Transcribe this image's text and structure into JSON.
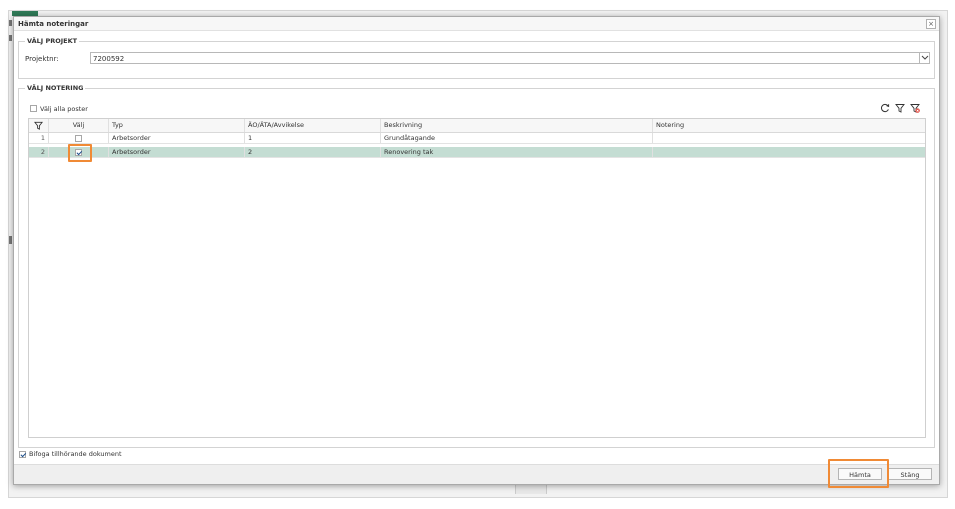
{
  "dialog": {
    "title": "Hämta noteringar",
    "close_glyph": "×"
  },
  "project_section": {
    "legend": "VÄLJ PROJEKT",
    "label": "Projektnr:",
    "value": "7200592"
  },
  "notes_section": {
    "legend": "VÄLJ NOTERING",
    "select_all_label": "Välj alla poster",
    "select_all_checked": false,
    "toolbar_icons": [
      "refresh-icon",
      "filter-icon",
      "clear-filter-icon"
    ]
  },
  "grid": {
    "columns": [
      "Välj",
      "Typ",
      "ÄO/ÄTA/Avvikelse",
      "Beskrivning",
      "Notering"
    ],
    "rows": [
      {
        "num": "1",
        "checked": false,
        "typ": "Arbetsorder",
        "code": "1",
        "beskrivning": "Grundåtagande",
        "notering": ""
      },
      {
        "num": "2",
        "checked": true,
        "typ": "Arbetsorder",
        "code": "2",
        "beskrivning": "Renovering tak",
        "notering": ""
      }
    ],
    "selected_row": 2
  },
  "attach": {
    "label": "Bifoga tillhörande dokument",
    "checked": true
  },
  "buttons": {
    "fetch": "Hämta",
    "close": "Stäng"
  },
  "colors": {
    "accent_highlight": "#f08a35",
    "selected_row": "#c4ddd3",
    "brand_green": "#2f7a57"
  }
}
